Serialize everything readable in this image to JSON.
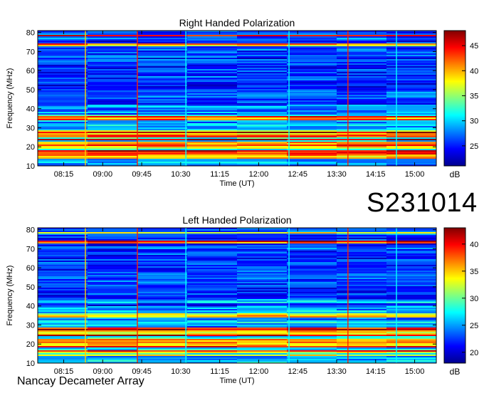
{
  "event_id": "S231014",
  "footer": "Nancay Decameter Array",
  "colors": {
    "colormap": [
      "#00008f",
      "#0000ff",
      "#0080ff",
      "#00ffff",
      "#80ff80",
      "#ffff00",
      "#ff8000",
      "#ff0000",
      "#800000"
    ],
    "border": "#000000"
  },
  "chart_data": [
    {
      "type": "heatmap",
      "title": "Right Handed Polarization",
      "xlabel": "Time (UT)",
      "ylabel": "Frequency (MHz)",
      "xlim": [
        "07:45",
        "15:25"
      ],
      "ylim": [
        10,
        81
      ],
      "x_ticks": [
        "08:15",
        "09:00",
        "09:45",
        "10:30",
        "11:15",
        "12:00",
        "12:45",
        "13:30",
        "14:15",
        "15:00"
      ],
      "y_ticks": [
        10,
        20,
        30,
        40,
        50,
        60,
        70,
        80
      ],
      "colorbar": {
        "label": "dB",
        "range": [
          21,
          48
        ],
        "ticks": [
          25,
          30,
          35,
          40,
          45
        ]
      },
      "intense_bands_mhz": [
        [
          16,
          18
        ],
        [
          19,
          23
        ],
        [
          25,
          28
        ],
        [
          34,
          36
        ],
        [
          73,
          74
        ],
        [
          78,
          79
        ]
      ],
      "vertical_lines": [
        {
          "time": "08:40",
          "color": "#ffd000"
        },
        {
          "time": "09:40",
          "color": "#ff2000"
        },
        {
          "time": "10:36",
          "color": "#00ffff"
        },
        {
          "time": "12:35",
          "color": "#00ffff"
        },
        {
          "time": "13:43",
          "color": "#ff2000"
        },
        {
          "time": "14:39",
          "color": "#00ffff"
        }
      ]
    },
    {
      "type": "heatmap",
      "title": "Left Handed Polarization",
      "xlabel": "Time (UT)",
      "ylabel": "Frequency (MHz)",
      "xlim": [
        "07:45",
        "15:25"
      ],
      "ylim": [
        10,
        81
      ],
      "x_ticks": [
        "08:15",
        "09:00",
        "09:45",
        "10:30",
        "11:15",
        "12:00",
        "12:45",
        "13:30",
        "14:15",
        "15:00"
      ],
      "y_ticks": [
        10,
        20,
        30,
        40,
        50,
        60,
        70,
        80
      ],
      "colorbar": {
        "label": "dB",
        "range": [
          18,
          43
        ],
        "ticks": [
          20,
          25,
          30,
          35,
          40
        ]
      },
      "intense_bands_mhz": [
        [
          15,
          17
        ],
        [
          18,
          23
        ],
        [
          25,
          28
        ],
        [
          34,
          36
        ],
        [
          73,
          74
        ],
        [
          78,
          79
        ]
      ],
      "vertical_lines": [
        {
          "time": "08:40",
          "color": "#ffd000"
        },
        {
          "time": "09:40",
          "color": "#ff2000"
        },
        {
          "time": "10:36",
          "color": "#00ffff"
        },
        {
          "time": "12:35",
          "color": "#00ffff"
        },
        {
          "time": "13:43",
          "color": "#ff2000"
        },
        {
          "time": "14:39",
          "color": "#00ffff"
        }
      ]
    }
  ]
}
